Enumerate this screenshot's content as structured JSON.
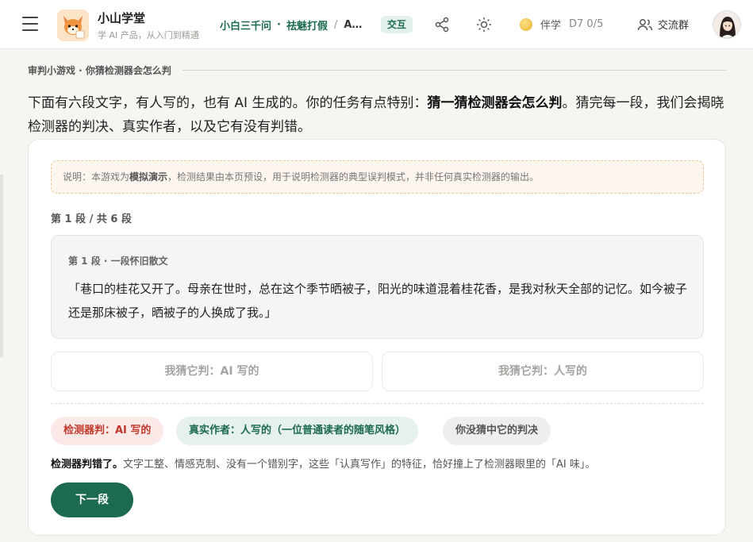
{
  "header": {
    "brand_title": "小山学堂",
    "brand_subtitle": "学 AI 产品，从入门到精通",
    "breadcrumb": {
      "part1": "小白三千问",
      "dot": "·",
      "part2": "祛魅打假",
      "sep": "/",
      "part3": "A…"
    },
    "tag": "交互",
    "companion_label": "伴学",
    "companion_progress": "D7 0/5",
    "group_label": "交流群",
    "icons": [
      "menu-icon",
      "share-icon",
      "sun-icon",
      "coin-icon",
      "users-icon"
    ]
  },
  "section": {
    "title": "审判小游戏 · 你猜检测器会怎么判"
  },
  "intro": {
    "before": "下面有六段文字，有人写的，也有 AI 生成的。你的任务有点特别：",
    "bold": "猜一猜检测器会怎么判",
    "after": "。猜完每一段，我们会揭晓检测器的判决、真实作者，以及它有没有判错。"
  },
  "card": {
    "note_prefix": "说明：本游戏为",
    "note_bold": "模拟演示",
    "note_suffix": "，检测结果由本页预设，用于说明检测器的典型误判模式，并非任何真实检测器的输出。",
    "progress": "第 1 段 / 共 6 段",
    "passage_title": "第 1 段 · 一段怀旧散文",
    "passage_text": "「巷口的桂花又开了。母亲在世时，总在这个季节晒被子，阳光的味道混着桂花香，是我对秋天全部的记忆。如今被子还是那床被子，晒被子的人换成了我。」",
    "choice_ai": "我猜它判：AI 写的",
    "choice_human": "我猜它判：人写的",
    "badge_detector": "检测器判：AI 写的",
    "badge_author": "真实作者：人写的（一位普通读者的随笔风格）",
    "badge_result": "你没猜中它的判决",
    "verdict_bold": "检测器判错了。",
    "verdict_text": "文字工整、情感克制、没有一个错别字，这些「认真写作」的特征，恰好撞上了检测器眼里的「AI 味」。",
    "next_button": "下一段"
  },
  "colors": {
    "accent_green": "#1d6b4f",
    "detector_red": "#c0392b",
    "note_border": "#ecc79b"
  }
}
